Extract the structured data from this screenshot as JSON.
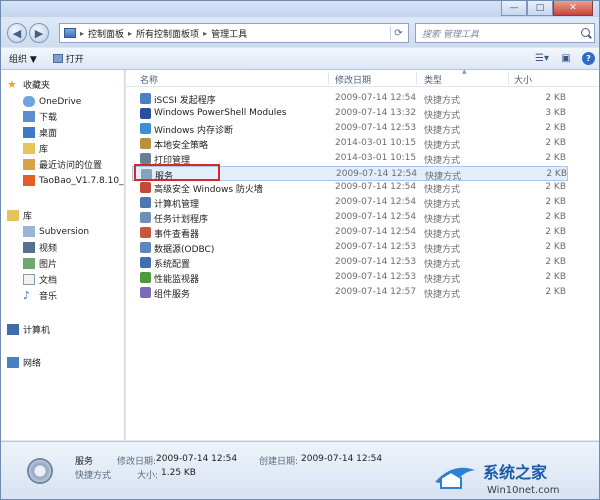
{
  "window": {
    "controls": [
      "—",
      "□",
      "✕"
    ]
  },
  "address": {
    "crumbs": [
      "控制面板",
      "所有控制面板项",
      "管理工具"
    ],
    "search_placeholder": "搜索 管理工具"
  },
  "toolbar": {
    "organize": "组织 ▼",
    "open": "打开"
  },
  "nav": {
    "favorites_header": "收藏夹",
    "favorites": [
      "OneDrive",
      "下载",
      "桌面",
      "库",
      "最近访问的位置",
      "TaoBao_V1.7.8.10_"
    ],
    "libraries_header": "库",
    "libraries": [
      "Subversion",
      "视频",
      "图片",
      "文档",
      "音乐"
    ],
    "computer": "计算机",
    "network": "网络"
  },
  "columns": {
    "name": "名称",
    "date": "修改日期",
    "type": "类型",
    "size": "大小"
  },
  "files": [
    {
      "name": "iSCSI 发起程序",
      "date": "2009-07-14 12:54",
      "type": "快捷方式",
      "size": "2 KB",
      "color": "#4a7fc4"
    },
    {
      "name": "Windows PowerShell Modules",
      "date": "2009-07-14 13:32",
      "type": "快捷方式",
      "size": "3 KB",
      "color": "#2b4f9e"
    },
    {
      "name": "Windows 内存诊断",
      "date": "2009-07-14 12:53",
      "type": "快捷方式",
      "size": "2 KB",
      "color": "#3d8fd1"
    },
    {
      "name": "本地安全策略",
      "date": "2014-03-01 10:15",
      "type": "快捷方式",
      "size": "2 KB",
      "color": "#b8913c"
    },
    {
      "name": "打印管理",
      "date": "2014-03-01 10:15",
      "type": "快捷方式",
      "size": "2 KB",
      "color": "#6a7f96"
    },
    {
      "name": "服务",
      "date": "2009-07-14 12:54",
      "type": "快捷方式",
      "size": "2 KB",
      "color": "#8aa0bb"
    },
    {
      "name": "高级安全 Windows 防火墙",
      "date": "2009-07-14 12:54",
      "type": "快捷方式",
      "size": "2 KB",
      "color": "#c24b35"
    },
    {
      "name": "计算机管理",
      "date": "2009-07-14 12:54",
      "type": "快捷方式",
      "size": "2 KB",
      "color": "#4b78b0"
    },
    {
      "name": "任务计划程序",
      "date": "2009-07-14 12:54",
      "type": "快捷方式",
      "size": "2 KB",
      "color": "#6e8fb7"
    },
    {
      "name": "事件查看器",
      "date": "2009-07-14 12:54",
      "type": "快捷方式",
      "size": "2 KB",
      "color": "#c8553c"
    },
    {
      "name": "数据源(ODBC)",
      "date": "2009-07-14 12:53",
      "type": "快捷方式",
      "size": "2 KB",
      "color": "#5b86c0"
    },
    {
      "name": "系统配置",
      "date": "2009-07-14 12:53",
      "type": "快捷方式",
      "size": "2 KB",
      "color": "#3f6fb1"
    },
    {
      "name": "性能监视器",
      "date": "2009-07-14 12:53",
      "type": "快捷方式",
      "size": "2 KB",
      "color": "#4c9a3c"
    },
    {
      "name": "组件服务",
      "date": "2009-07-14 12:57",
      "type": "快捷方式",
      "size": "2 KB",
      "color": "#7d6cb3"
    }
  ],
  "details": {
    "name": "服务",
    "type": "快捷方式",
    "modified_label": "修改日期:",
    "modified": "2009-07-14 12:54",
    "created_label": "创建日期:",
    "created": "2009-07-14 12:54",
    "size_label": "大小:",
    "size": "1.25 KB"
  },
  "watermark": {
    "title": "系统之家",
    "url": "Win10net.com"
  }
}
